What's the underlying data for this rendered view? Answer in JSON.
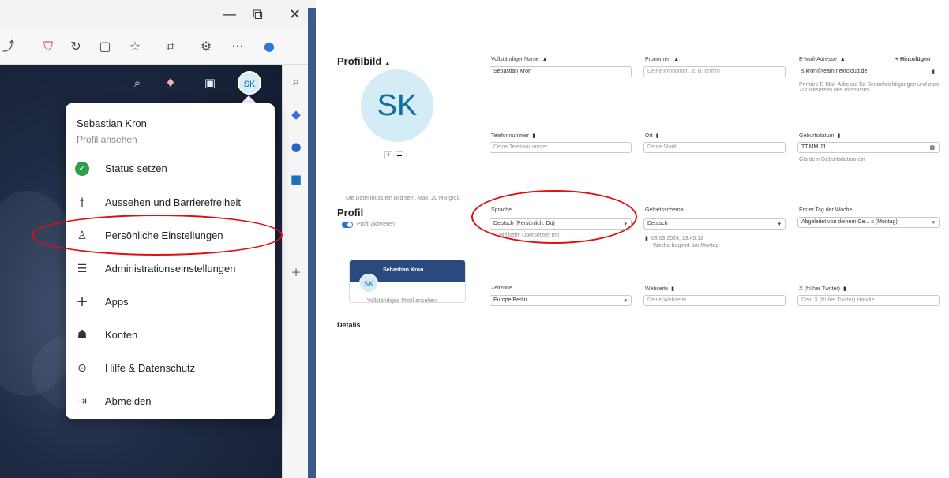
{
  "browser": {
    "window_buttons": [
      "—",
      "⧉",
      "✕"
    ],
    "toolbar_icons": [
      "⤴",
      "⛉",
      "↻",
      "▢",
      "☆",
      "⧉",
      "⚙",
      "···",
      "●"
    ]
  },
  "app_header": {
    "avatar_initials": "SK"
  },
  "account_menu": {
    "user_name": "Sebastian Kron",
    "view_profile": "Profil ansehen",
    "items": [
      {
        "label": "Status setzen",
        "icon": "status-check-icon"
      },
      {
        "label": "Aussehen und Barrierefreiheit",
        "icon": "accessibility-icon"
      },
      {
        "label": "Persönliche Einstellungen",
        "icon": "person-icon"
      },
      {
        "label": "Administrationseinstellungen",
        "icon": "admin-sliders-icon"
      },
      {
        "label": "Apps",
        "icon": "plus-icon"
      },
      {
        "label": "Konten",
        "icon": "accounts-icon"
      },
      {
        "label": "Hilfe & Datenschutz",
        "icon": "help-icon"
      },
      {
        "label": "Abmelden",
        "icon": "logout-icon"
      }
    ],
    "highlighted_item": "Persönliche Einstellungen"
  },
  "settings": {
    "profile_picture_title": "Profilbild",
    "avatar_initials": "SK",
    "avatar_hint": "Die Datei muss ein Bild sein. Max. 20 MB groß",
    "profile_title": "Profil",
    "profile_toggle_label": "Profil aktivieren",
    "profile_card_name": "Sebastian Kron",
    "profile_link": "Vollständiges Profil ansehen",
    "details_title": "Details",
    "fields": {
      "full_name": {
        "label": "Vollständiger Name",
        "value": "Sebastian Kron"
      },
      "pronouns": {
        "label": "Pronomen",
        "placeholder": "Deine Pronomen, z. B. er/ihm"
      },
      "email": {
        "label": "E-Mail-Adresse",
        "value": "s.kron@team.nextcloud.de",
        "add": "+ Hinzufügen",
        "hint": "Primäre E-Mail-Adresse für Benachrichtigungen und zum Zurücksetzen des Passworts"
      },
      "phone": {
        "label": "Telefonnummer",
        "placeholder": "Deine Telefonnummer"
      },
      "location": {
        "label": "Ort",
        "placeholder": "Deine Stadt"
      },
      "birthday": {
        "label": "Geburtsdatum",
        "value": "TT.MM.JJ",
        "hint": "Gib dein Geburtsdatum ein"
      },
      "language": {
        "label": "Sprache",
        "value": "Deutsch (Persönlich: Du)",
        "hint": "Hilf beim Übersetzen mit"
      },
      "locale": {
        "label": "Gebietsschema",
        "value": "Deutsch",
        "hint1": "03.03.2024, 13:45:12",
        "hint2": "Woche beginnt am Montag"
      },
      "first_day": {
        "label": "Erster Tag der Woche",
        "value": "Abgeleitet von deinem Ge... s (Montag)"
      },
      "timezone": {
        "label": "Zeitzone",
        "value": "Europe/Berlin"
      },
      "website": {
        "label": "Webseite",
        "placeholder": "Deine Webseite"
      },
      "twitter": {
        "label": "X (früher Twitter)",
        "placeholder": "Dein X (früher Twitter) Handle"
      }
    },
    "highlighted_field": "Sprache"
  }
}
